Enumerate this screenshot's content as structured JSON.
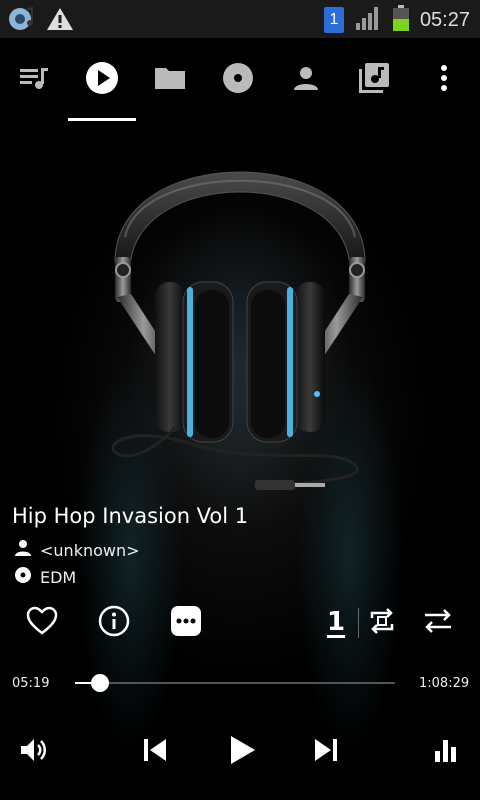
{
  "status_bar": {
    "sim_number": "1",
    "time": "05:27",
    "icons": [
      "media-app-icon",
      "warning-icon",
      "sim-icon",
      "signal-icon",
      "battery-icon"
    ]
  },
  "tabs": [
    {
      "name": "queue",
      "icon": "queue-icon"
    },
    {
      "name": "now-playing",
      "icon": "play-icon",
      "active": true
    },
    {
      "name": "folders",
      "icon": "folder-icon"
    },
    {
      "name": "albums",
      "icon": "disc-icon"
    },
    {
      "name": "artists",
      "icon": "person-icon"
    },
    {
      "name": "playlists",
      "icon": "playlist-icon"
    },
    {
      "name": "more",
      "icon": "more-vert-icon"
    }
  ],
  "track": {
    "title": "Hip Hop Invasion Vol 1",
    "artist": "<unknown>",
    "album": "EDM"
  },
  "actions": {
    "repeat_count": "1"
  },
  "progress": {
    "elapsed": "05:19",
    "total": "1:08:29",
    "fraction": 0.078
  },
  "colors": {
    "accent": "#ffffff",
    "background": "#000000",
    "status_bar": "#1a1a1a",
    "sim_badge": "#2b6fd6",
    "battery": "#7ed321",
    "headphone_glow": "#4fc3f7"
  }
}
